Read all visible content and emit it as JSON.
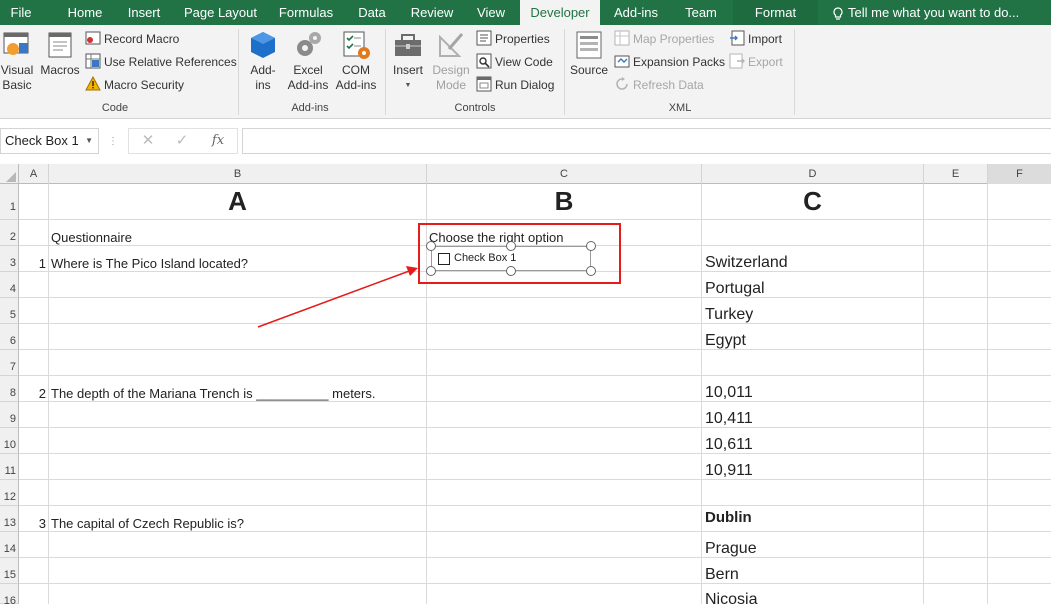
{
  "ribbon_tabs": {
    "file": "File",
    "home": "Home",
    "insert": "Insert",
    "page_layout": "Page Layout",
    "formulas": "Formulas",
    "data": "Data",
    "review": "Review",
    "view": "View",
    "developer": "Developer",
    "add_ins": "Add-ins",
    "team": "Team",
    "format": "Format",
    "tell_me": "Tell me what you want to do..."
  },
  "ribbon": {
    "code": {
      "visual_basic": "Visual\nBasic",
      "macros": "Macros",
      "record_macro": "Record Macro",
      "use_relative_references": "Use Relative References",
      "macro_security": "Macro Security",
      "label": "Code"
    },
    "add_ins": {
      "add_ins": "Add-\nins",
      "excel_add_ins": "Excel\nAdd-ins",
      "com_add_ins": "COM\nAdd-ins",
      "label": "Add-ins"
    },
    "controls": {
      "insert": "Insert",
      "design_mode": "Design\nMode",
      "properties": "Properties",
      "view_code": "View Code",
      "run_dialog": "Run Dialog",
      "label": "Controls"
    },
    "xml": {
      "source": "Source",
      "map_properties": "Map Properties",
      "expansion_packs": "Expansion Packs",
      "refresh_data": "Refresh Data",
      "import": "Import",
      "export": "Export",
      "label": "XML"
    }
  },
  "formula_bar": {
    "name_box": "Check Box 1",
    "formula": ""
  },
  "columns": [
    "A",
    "B",
    "C",
    "D",
    "E",
    "F"
  ],
  "rows": [
    "1",
    "2",
    "3",
    "4",
    "5",
    "6",
    "7",
    "8",
    "9",
    "10",
    "11",
    "12",
    "13",
    "14",
    "15",
    "16"
  ],
  "sheet": {
    "headers": {
      "b1": "A",
      "c1": "B",
      "d1": "C"
    },
    "b2": "Questionnaire",
    "c2": "Choose the right option",
    "questions": [
      {
        "num": "1",
        "text": "Where is The Pico Island located?"
      },
      {
        "num": "2",
        "text": "The depth of the Mariana Trench is __________ meters."
      },
      {
        "num": "3",
        "text": "The capital of Czech Republic is?"
      }
    ],
    "options": {
      "q1": [
        "Switzerland",
        "Portugal",
        "Turkey",
        "Egypt"
      ],
      "q2": [
        "10,011",
        "10,411",
        "10,611",
        "10,911"
      ],
      "q3": [
        "Dublin",
        "Prague",
        "Bern",
        "Nicosia"
      ]
    }
  },
  "checkbox": {
    "label": "Check Box 1",
    "checked": false
  },
  "colors": {
    "ribbon_green": "#217346",
    "highlight_red": "#e31c1c"
  }
}
